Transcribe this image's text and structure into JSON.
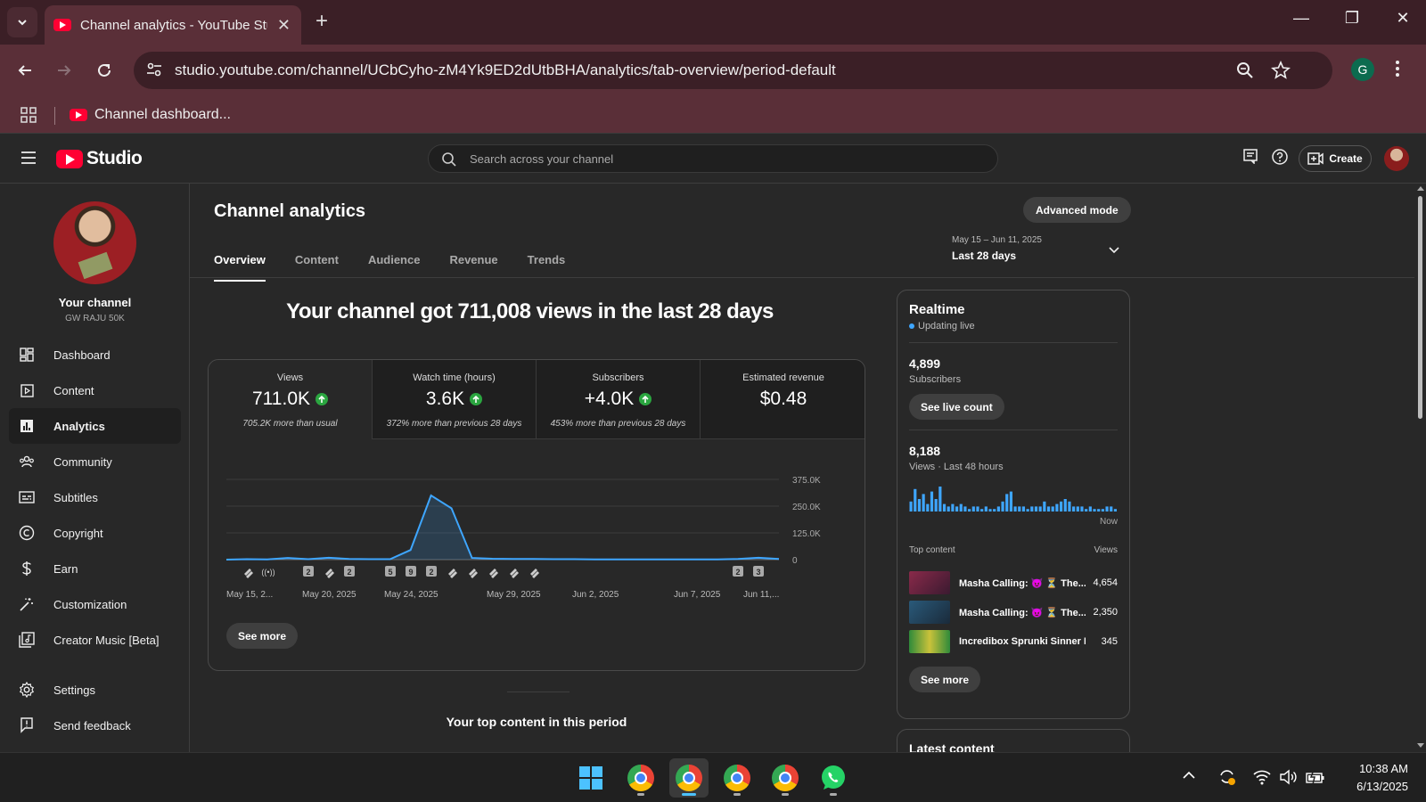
{
  "browser": {
    "tab_title": "Channel analytics - YouTube Studio",
    "url": "studio.youtube.com/channel/UCbCyho-zM4Yk9ED2dUtbBHA/analytics/tab-overview/period-default",
    "profile_initial": "G",
    "bookmark_label": "Channel dashboard..."
  },
  "studio": {
    "logo_text": "Studio",
    "search_placeholder": "Search across your channel",
    "create_label": "Create"
  },
  "sidebar": {
    "your_channel_label": "Your channel",
    "channel_name": "GW RAJU 50K",
    "items": [
      {
        "label": "Dashboard",
        "icon": "dashboard-icon"
      },
      {
        "label": "Content",
        "icon": "content-icon"
      },
      {
        "label": "Analytics",
        "icon": "analytics-icon",
        "active": true
      },
      {
        "label": "Community",
        "icon": "community-icon"
      },
      {
        "label": "Subtitles",
        "icon": "subtitles-icon"
      },
      {
        "label": "Copyright",
        "icon": "copyright-icon"
      },
      {
        "label": "Earn",
        "icon": "earn-icon"
      },
      {
        "label": "Customization",
        "icon": "customization-icon"
      },
      {
        "label": "Creator Music [Beta]",
        "icon": "creator-music-icon"
      },
      {
        "label": "Settings",
        "icon": "settings-icon"
      },
      {
        "label": "Send feedback",
        "icon": "feedback-icon"
      }
    ]
  },
  "main": {
    "page_title": "Channel analytics",
    "advanced_mode_label": "Advanced mode",
    "tabs": [
      "Overview",
      "Content",
      "Audience",
      "Revenue",
      "Trends"
    ],
    "active_tab": "Overview",
    "date_range": "May 15 – Jun 11, 2025",
    "period_label": "Last 28 days",
    "headline": "Your channel got 711,008 views in the last 28 days",
    "metrics": [
      {
        "label": "Views",
        "value": "711.0K",
        "up": true,
        "note": "705.2K more than usual"
      },
      {
        "label": "Watch time (hours)",
        "value": "3.6K",
        "up": true,
        "note": "372% more than previous 28 days"
      },
      {
        "label": "Subscribers",
        "value": "+4.0K",
        "up": true,
        "note": "453% more than previous 28 days"
      },
      {
        "label": "Estimated revenue",
        "value": "$0.48",
        "up": false,
        "note": ""
      }
    ],
    "see_more_label": "See more",
    "top_content_title": "Your top content in this period"
  },
  "chart_data": {
    "type": "area",
    "title": "",
    "xlabel": "",
    "ylabel": "",
    "ylim": [
      0,
      375000
    ],
    "yticks": [
      "375.0K",
      "250.0K",
      "125.0K",
      "0"
    ],
    "xtick_labels": [
      "May 15, 2...",
      "May 20, 2025",
      "May 24, 2025",
      "May 29, 2025",
      "Jun 2, 2025",
      "Jun 7, 2025",
      "Jun 11,..."
    ],
    "series": [
      {
        "values": [
          0,
          2000,
          1000,
          8000,
          2000,
          9000,
          3000,
          2000,
          2000,
          45000,
          300000,
          240000,
          8000,
          4000,
          3000,
          3000,
          2000,
          2000,
          1000,
          1000,
          1000,
          1000,
          1000,
          1000,
          1000,
          3000,
          9000,
          3000
        ]
      }
    ],
    "markers": [
      "shorts",
      "live",
      "2",
      "shorts",
      "2",
      "5",
      "9",
      "2",
      "shorts",
      "shorts",
      "shorts",
      "shorts",
      "shorts",
      "2",
      "3"
    ],
    "color": "#3ea6ff",
    "grid": true
  },
  "realtime": {
    "title": "Realtime",
    "status": "Updating live",
    "subscribers_value": "4,899",
    "subscribers_label": "Subscribers",
    "see_live_count_label": "See live count",
    "views_value": "8,188",
    "views_label": "Views · Last 48 hours",
    "now_label": "Now",
    "bars": [
      0.4,
      0.9,
      0.5,
      0.7,
      0.3,
      0.8,
      0.5,
      1.0,
      0.3,
      0.2,
      0.3,
      0.2,
      0.3,
      0.2,
      0.1,
      0.2,
      0.2,
      0.1,
      0.2,
      0.1,
      0.1,
      0.2,
      0.4,
      0.7,
      0.8,
      0.2,
      0.2,
      0.2,
      0.1,
      0.2,
      0.2,
      0.2,
      0.4,
      0.2,
      0.2,
      0.3,
      0.4,
      0.5,
      0.4,
      0.2,
      0.2,
      0.2,
      0.1,
      0.2,
      0.1,
      0.1,
      0.1,
      0.2,
      0.2,
      0.1
    ],
    "top_content_label": "Top content",
    "views_col_label": "Views",
    "top_items": [
      {
        "title": "Masha Calling: 😈 ⏳ The...",
        "views": "4,654",
        "thumb": "#8a2a4a"
      },
      {
        "title": "Masha Calling: 😈 ⏳ The...",
        "views": "2,350",
        "thumb": "#2a5a7a"
      },
      {
        "title": "Incredibox Sprunki Sinner E...",
        "views": "345",
        "thumb": "#2f8a3a"
      }
    ],
    "see_more_label": "See more"
  },
  "latest_content": {
    "title": "Latest content"
  },
  "taskbar": {
    "time": "10:38 AM",
    "date": "6/13/2025"
  }
}
